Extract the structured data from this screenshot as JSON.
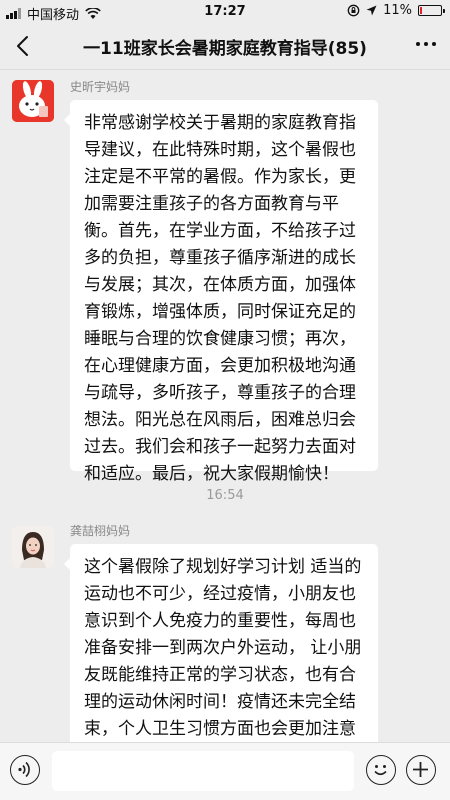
{
  "status": {
    "carrier": "中国移动",
    "time": "17:27",
    "battery": "11%",
    "battery_level": 0.11
  },
  "header": {
    "title": "一11班家长会暑期家庭教育指导(85)",
    "back_icon": "chevron-left-icon",
    "more_icon": "more-dots-icon"
  },
  "messages": [
    {
      "sender": "史昕宇妈妈",
      "text": "非常感谢学校关于暑期的家庭教育指导建议，在此特殊时期，这个暑假也注定是不平常的暑假。作为家长，更加需要注重孩子的各方面教育与平衡。首先，在学业方面，不给孩子过多的负担，尊重孩子循序渐进的成长与发展；其次，在体质方面，加强体育锻炼，增强体质，同时保证充足的睡眠与合理的饮食健康习惯；再次，在心理健康方面，会更加积极地沟通与疏导，多听孩子，尊重孩子的合理想法。阳光总在风雨后，困难总归会过去。我们会和孩子一起努力去面对和适应。最后，祝大家假期愉快！"
    },
    {
      "sender": "龚喆栩妈妈",
      "text": "这个暑假除了规划好学习计划 适当的运动也不可少，经过疫情，小朋友也意识到个人免疫力的重要性，每周也准备安排一到两次户外运动， 让小朋友既能维持正常的学习状态，也有合理的运动休闲时间！疫情还未完全结束，个人卫生习惯方面也会更加注意最后祝愿所有小朋友们都好好享受夏日时光"
    }
  ],
  "time_separator": "16:54",
  "input_bar": {
    "voice_icon": "voice-icon",
    "emoji_icon": "emoji-icon",
    "plus_icon": "plus-icon"
  }
}
